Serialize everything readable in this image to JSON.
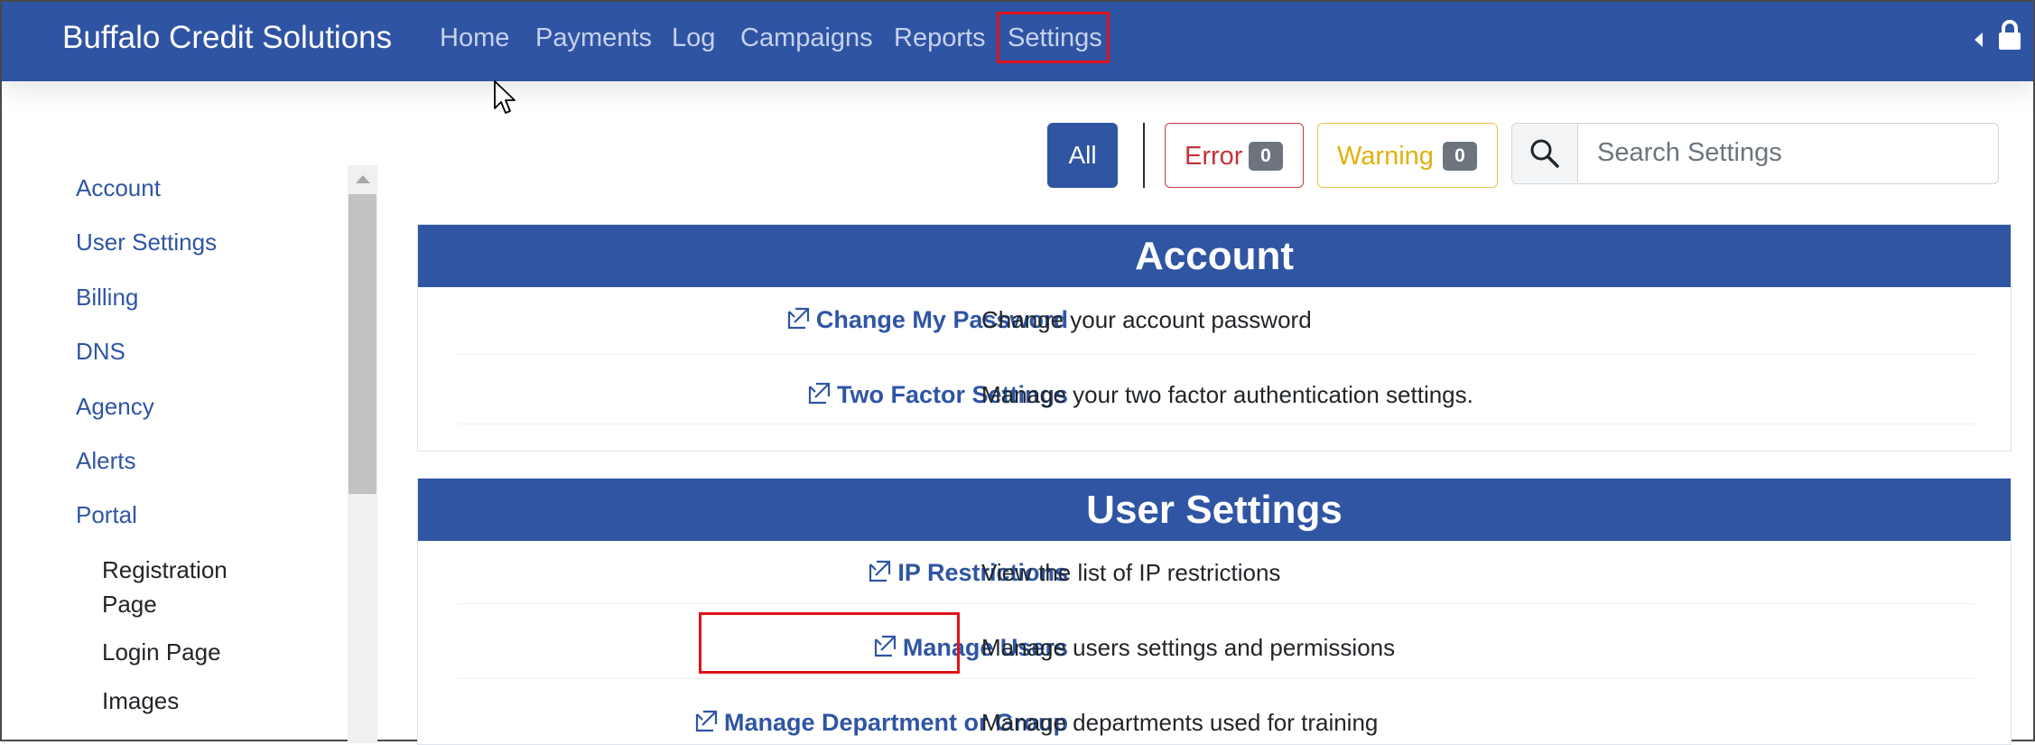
{
  "navbar": {
    "brand": "Buffalo Credit Solutions",
    "items": [
      {
        "label": "Home"
      },
      {
        "label": "Payments"
      },
      {
        "label": "Log"
      },
      {
        "label": "Campaigns"
      },
      {
        "label": "Reports"
      },
      {
        "label": "Settings",
        "active": true
      }
    ],
    "right_icons": [
      "caret-left-icon",
      "lock-icon"
    ]
  },
  "sidebar": {
    "items": [
      {
        "label": "Account"
      },
      {
        "label": "User Settings"
      },
      {
        "label": "Billing"
      },
      {
        "label": "DNS"
      },
      {
        "label": "Agency"
      },
      {
        "label": "Alerts"
      },
      {
        "label": "Portal"
      }
    ],
    "portal_subitems": [
      {
        "line1": "Registration",
        "line2": "Page"
      },
      {
        "line1": "Login Page"
      },
      {
        "line1": "Images"
      }
    ]
  },
  "filters": {
    "all_label": "All",
    "error_label": "Error",
    "error_count": "0",
    "warning_label": "Warning",
    "warning_count": "0",
    "search_placeholder": "Search Settings",
    "search_icon": "search-icon"
  },
  "sections": {
    "account": {
      "title": "Account",
      "rows": [
        {
          "link": "Change My Password",
          "desc": "Change your account password"
        },
        {
          "link": "Two Factor Settings",
          "desc": "Manage your two factor authentication settings."
        }
      ]
    },
    "user_settings": {
      "title": "User Settings",
      "rows": [
        {
          "link": "IP Restrictions",
          "desc": "View the list of IP restrictions"
        },
        {
          "link": "Manage Users",
          "desc": "Manage users settings and permissions"
        },
        {
          "link": "Manage Department or Group",
          "desc": "Manage departments used for training"
        }
      ]
    }
  },
  "colors": {
    "navbar": "#3054a4",
    "accent": "#2f55a3",
    "error": "#c0343a",
    "warning": "#e0b10d",
    "highlight": "#e0131a"
  }
}
